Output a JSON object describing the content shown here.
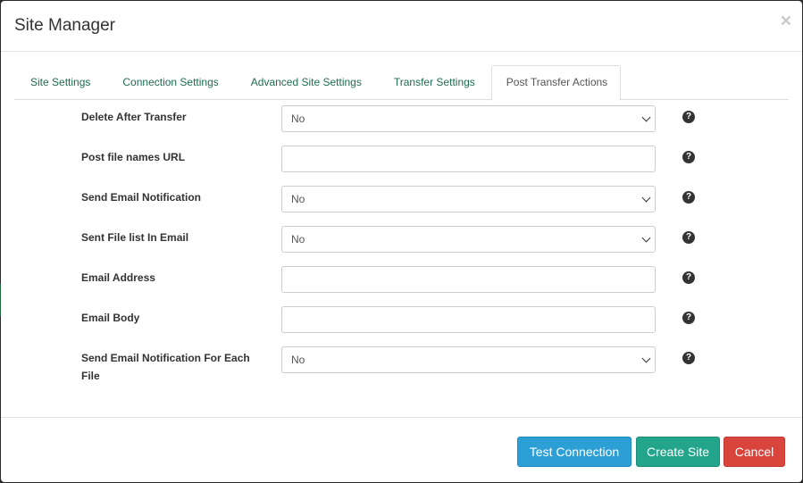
{
  "modal": {
    "title": "Site Manager",
    "close_symbol": "×"
  },
  "tabs": [
    {
      "label": "Site Settings",
      "active": false
    },
    {
      "label": "Connection Settings",
      "active": false
    },
    {
      "label": "Advanced Site Settings",
      "active": false
    },
    {
      "label": "Transfer Settings",
      "active": false
    },
    {
      "label": "Post Transfer Actions",
      "active": true
    }
  ],
  "fields": {
    "delete_after_transfer": {
      "label": "Delete After Transfer",
      "value": "No"
    },
    "post_file_names_url": {
      "label": "Post file names URL",
      "value": ""
    },
    "send_email_notification": {
      "label": "Send Email Notification",
      "value": "No"
    },
    "sent_file_list_in_email": {
      "label": "Sent File list In Email",
      "value": "No"
    },
    "email_address": {
      "label": "Email Address",
      "value": ""
    },
    "email_body": {
      "label": "Email Body",
      "value": ""
    },
    "send_email_notification_each_file": {
      "label": "Send Email Notification For Each File",
      "value": "No"
    }
  },
  "help_symbol": "?",
  "footer": {
    "test_connection_label": "Test Connection",
    "create_site_label": "Create Site",
    "cancel_label": "Cancel"
  },
  "colors": {
    "tab_link": "#1e6b4f",
    "test_button": "#2b9fd6",
    "create_button": "#22a58a",
    "cancel_button": "#d9453d"
  }
}
